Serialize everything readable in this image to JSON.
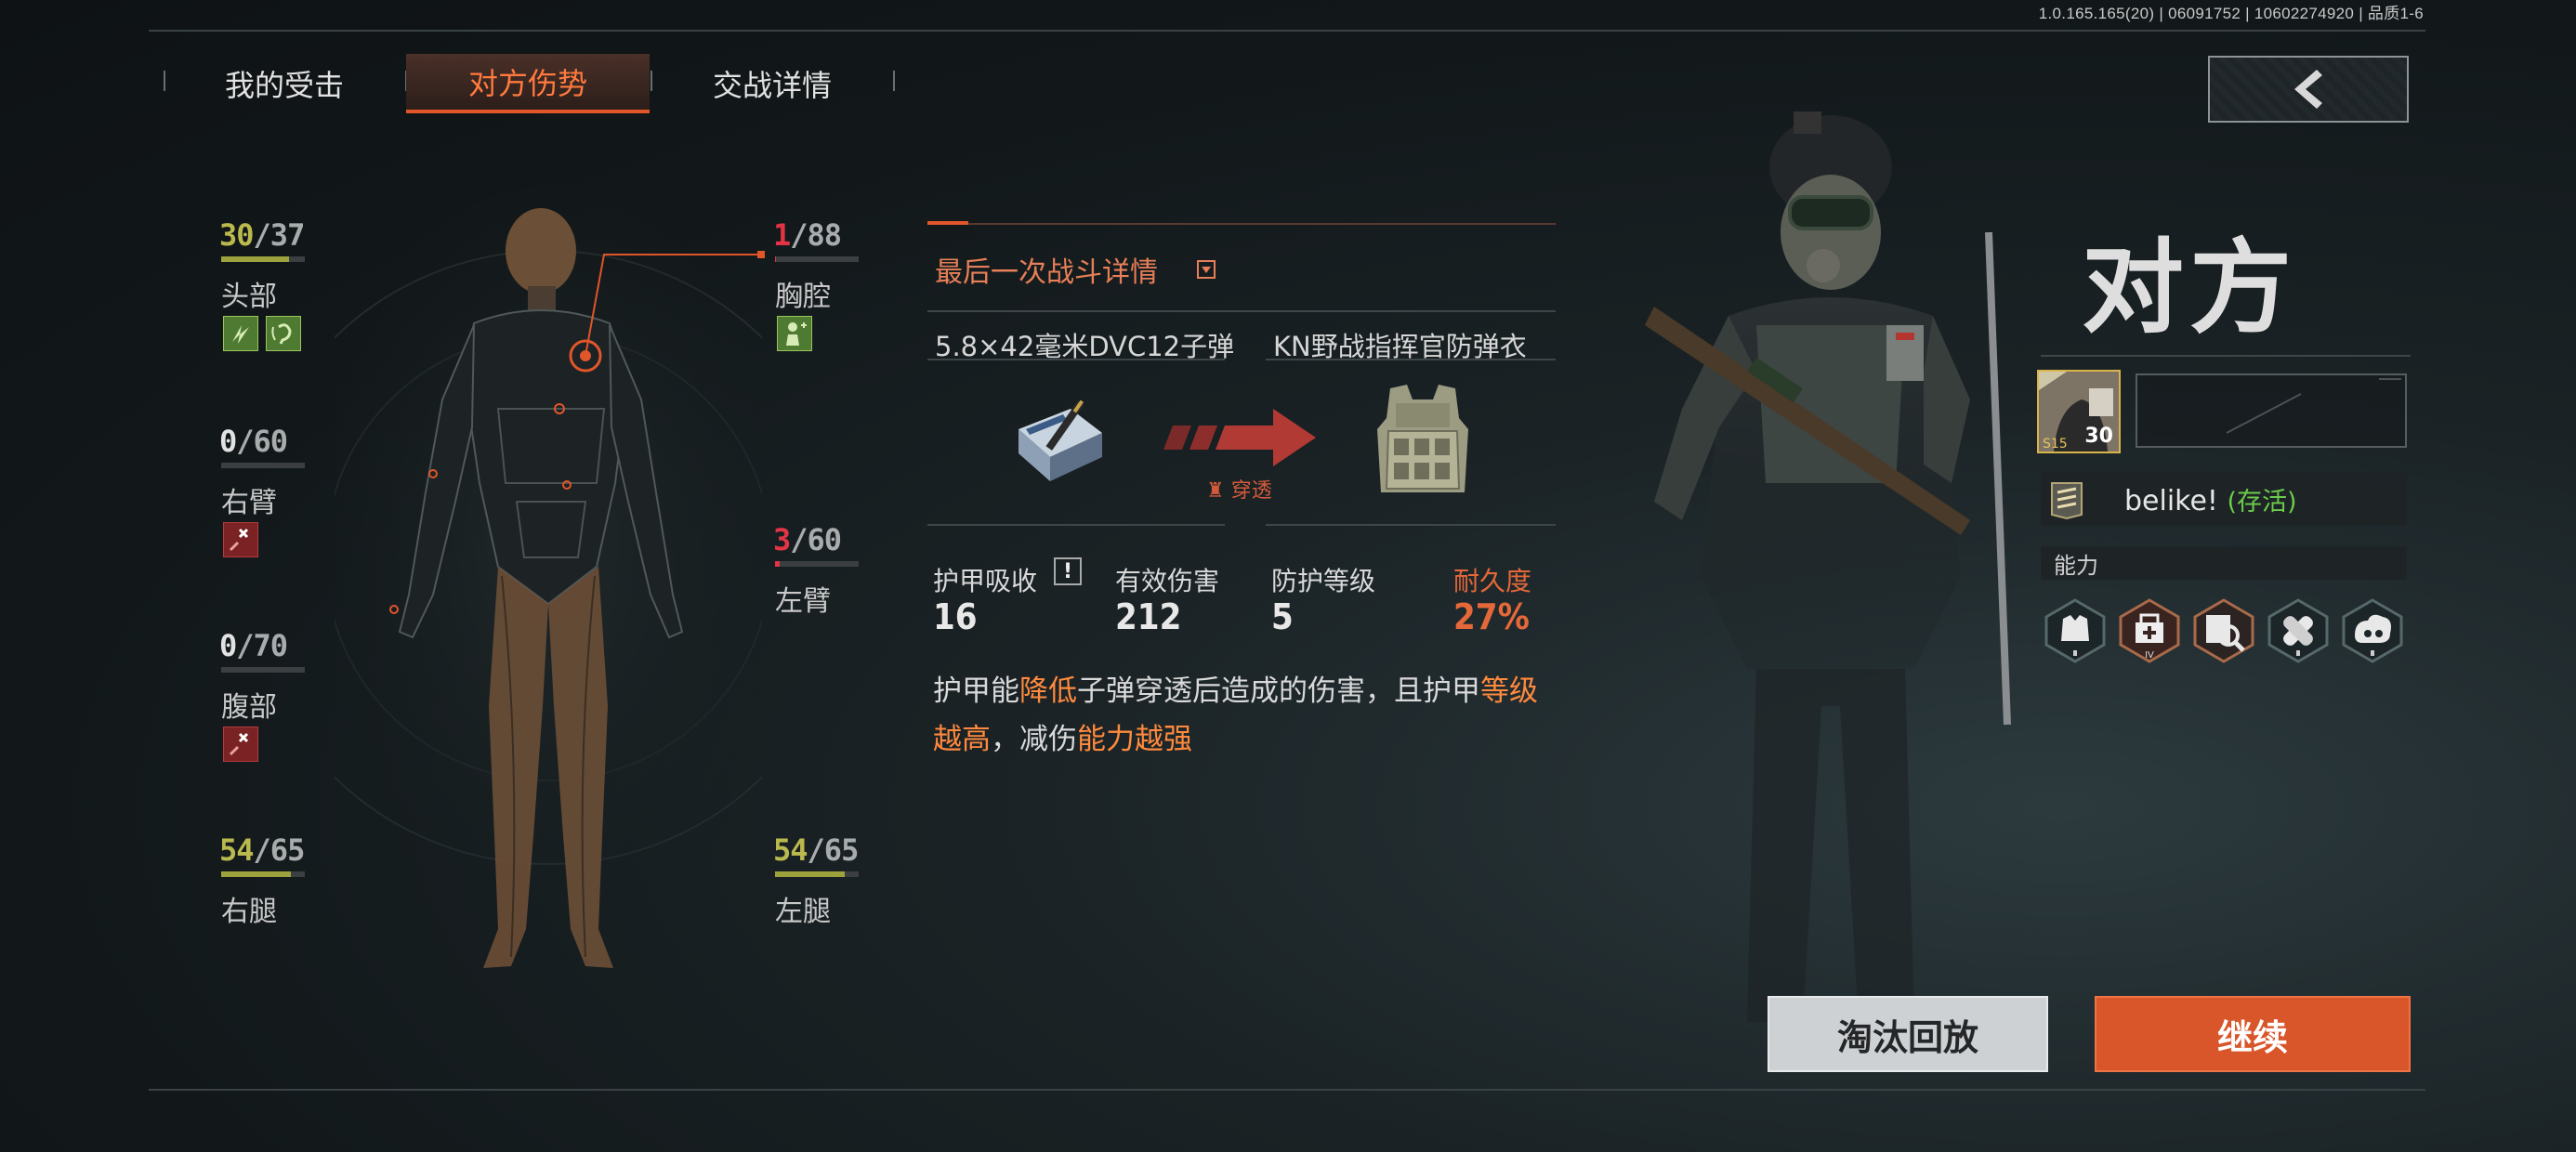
{
  "version_info": "1.0.165.165(20) | 06091752 | 10602274920 | 品质1-6",
  "tabs": [
    {
      "label": "我的受击",
      "active": false
    },
    {
      "label": "对方伤势",
      "active": true
    },
    {
      "label": "交战详情",
      "active": false
    }
  ],
  "body_parts": {
    "head": {
      "name": "头部",
      "current": "30",
      "max": "/37",
      "fraction": 0.81
    },
    "chest": {
      "name": "胸腔",
      "current": "1",
      "max": "/88",
      "fraction": 0.01
    },
    "right_arm": {
      "name": "右臂",
      "current": "0",
      "max": "/60",
      "fraction": 0
    },
    "left_arm": {
      "name": "左臂",
      "current": "3",
      "max": "/60",
      "fraction": 0.05
    },
    "abdomen": {
      "name": "腹部",
      "current": "0",
      "max": "/70",
      "fraction": 0
    },
    "right_leg": {
      "name": "右腿",
      "current": "54",
      "max": "/65",
      "fraction": 0.83
    },
    "left_leg": {
      "name": "左腿",
      "current": "54",
      "max": "/65",
      "fraction": 0.83
    }
  },
  "detail": {
    "title": "最后一次战斗详情",
    "ammo": "5.8×42毫米DVC12子弹",
    "armor": "KN野战指挥官防弹衣",
    "penetrate_label": "穿透",
    "stats": [
      {
        "label": "护甲吸收",
        "value": "16"
      },
      {
        "label": "有效伤害",
        "value": "212"
      },
      {
        "label": "防护等级",
        "value": "5"
      },
      {
        "label": "耐久度",
        "value": "27%"
      }
    ],
    "desc_parts": [
      "护甲能",
      "降低",
      "子弹穿透后造成的伤害，且护甲",
      "等级越高",
      "，减伤",
      "能力越强"
    ]
  },
  "opponent": {
    "title": "对方",
    "avatar_level": "30",
    "avatar_tag": "S15",
    "player_name": "belike!",
    "status": "(存活)",
    "ability_label": "能力",
    "abilities": [
      "armor-icon",
      "supply-icon",
      "search-icon",
      "medic-icon",
      "assault-icon"
    ]
  },
  "buttons": {
    "replay": "淘汰回放",
    "continue": "继续"
  },
  "colors": {
    "accent": "#e0562a",
    "hp_yellow": "#b9b94e",
    "hp_red": "#e23444",
    "alive_green": "#6ccb4c"
  }
}
